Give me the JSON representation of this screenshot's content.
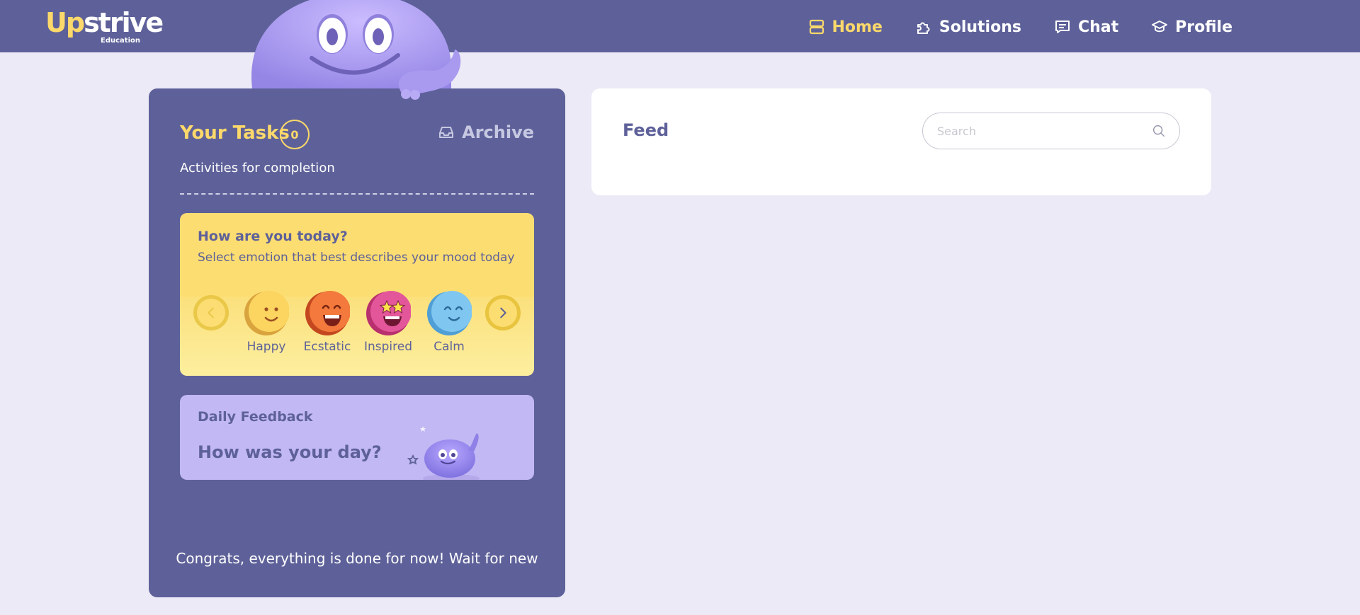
{
  "brand": {
    "name_first": "Up",
    "name_rest": "strive",
    "subtitle": "Education"
  },
  "nav": {
    "items": [
      {
        "label": "Home",
        "icon": "home-icon",
        "active": true
      },
      {
        "label": "Solutions",
        "icon": "puzzle-icon",
        "active": false
      },
      {
        "label": "Chat",
        "icon": "chat-icon",
        "active": false
      },
      {
        "label": "Profile",
        "icon": "graduation-cap-icon",
        "active": false
      }
    ]
  },
  "tasks": {
    "title": "Your Tasks",
    "count": "0",
    "archive_label": "Archive",
    "subtitle": "Activities for completion"
  },
  "mood": {
    "title": "How are you today?",
    "subtitle": "Select emotion that best describes your mood today",
    "emotions": [
      {
        "label": "Happy",
        "icon": "happy-face-icon"
      },
      {
        "label": "Ecstatic",
        "icon": "ecstatic-face-icon"
      },
      {
        "label": "Inspired",
        "icon": "star-eyes-face-icon"
      },
      {
        "label": "Calm",
        "icon": "calm-face-icon"
      }
    ]
  },
  "feedback": {
    "label": "Daily Feedback",
    "title": "How was your day?"
  },
  "congrats": "Congrats, everything is done for now! Wait for new",
  "feed": {
    "title": "Feed",
    "search_placeholder": "Search"
  },
  "colors": {
    "primary": "#5e6199",
    "accent_yellow": "#fcd96a",
    "background": "#eceaf6",
    "mascot": "#a896f0",
    "feedback_card": "#c2b8f3"
  }
}
